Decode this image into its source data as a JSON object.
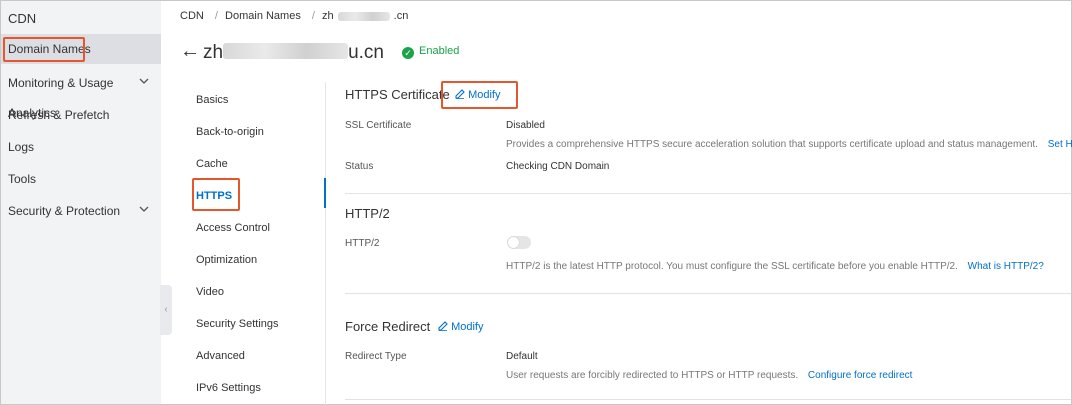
{
  "sidebar": {
    "title": "CDN",
    "items": [
      {
        "label": "Domain Names",
        "active": true
      },
      {
        "label": "Monitoring & Usage Analytics",
        "chevron": "chevron-down-icon"
      },
      {
        "label": "Refresh & Prefetch"
      },
      {
        "label": "Logs"
      },
      {
        "label": "Tools"
      },
      {
        "label": "Security & Protection",
        "chevron": "chevron-down-icon"
      }
    ]
  },
  "breadcrumb": {
    "items": [
      "CDN",
      "Domain Names"
    ],
    "separator": "/",
    "domain_prefix": "zh",
    "domain_suffix": ".cn"
  },
  "header": {
    "back_icon": "←",
    "domain_prefix": "zh",
    "domain_suffix": "u.cn",
    "status": "Enabled",
    "status_icon": "✓"
  },
  "settings_menu": {
    "items": [
      "Basics",
      "Back-to-origin",
      "Cache",
      "HTTPS",
      "Access Control",
      "Optimization",
      "Video",
      "Security Settings",
      "Advanced",
      "IPv6 Settings"
    ],
    "active_index": 3
  },
  "https_certificate": {
    "title": "HTTPS Certificate",
    "modify_label": "Modify",
    "ssl_label": "SSL Certificate",
    "ssl_value": "Disabled",
    "ssl_desc": "Provides a comprehensive HTTPS secure acceleration solution that supports certificate upload and status management.",
    "ssl_link": "Set HTTPS",
    "status_label": "Status",
    "status_value": "Checking CDN Domain"
  },
  "http2": {
    "title": "HTTP/2",
    "label": "HTTP/2",
    "enabled": false,
    "desc": "HTTP/2 is the latest HTTP protocol. You must configure the SSL certificate before you enable HTTP/2.",
    "link": "What is HTTP/2?"
  },
  "force_redirect": {
    "title": "Force Redirect",
    "modify_label": "Modify",
    "type_label": "Redirect Type",
    "type_value": "Default",
    "desc": "User requests are forcibly redirected to HTTPS or HTTP requests.",
    "link": "Configure force redirect"
  },
  "colors": {
    "accent": "#0070cc",
    "highlight": "#e4572e",
    "enabled": "#1aa34a"
  }
}
